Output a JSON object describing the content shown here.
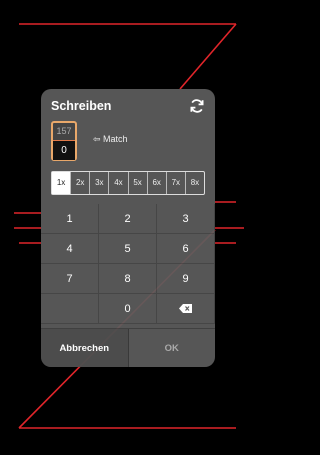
{
  "dialog": {
    "title": "Schreiben",
    "counter_top": "157",
    "counter_bottom": "0",
    "match_label": "⇦ Match",
    "multipliers": [
      "1x",
      "2x",
      "3x",
      "4x",
      "5x",
      "6x",
      "7x",
      "8x"
    ],
    "selected_multiplier": "1x",
    "keys": [
      "1",
      "2",
      "3",
      "4",
      "5",
      "6",
      "7",
      "8",
      "9",
      "",
      "0",
      "⌫"
    ],
    "cancel_label": "Abbrechen",
    "ok_label": "OK"
  },
  "colors": {
    "background": "#000000",
    "accent_line": "#e0252a",
    "counter_border": "#e9a86a"
  }
}
